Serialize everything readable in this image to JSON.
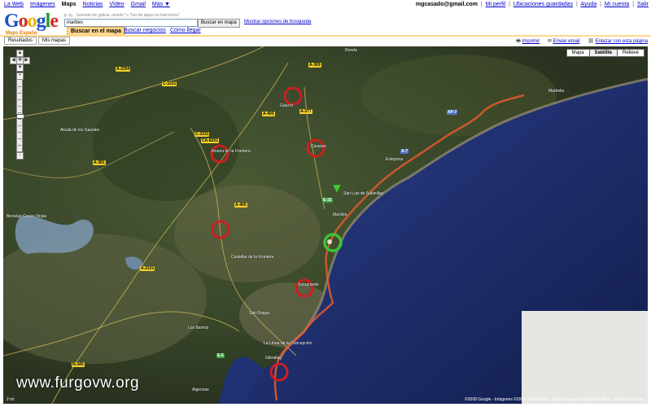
{
  "topnav": {
    "links": [
      "La Web",
      "Imágenes",
      "Maps",
      "Noticias",
      "Vídeo",
      "Gmail",
      "Más ▼"
    ],
    "active": "Maps",
    "user_email": "mgcasado@gmail.com",
    "user_links": [
      "Mi perfil",
      "Ubicaciones guardadas",
      "Ayuda",
      "Mi cuenta",
      "Salir"
    ]
  },
  "logo": {
    "word": "Google",
    "sub": "Maps España"
  },
  "search": {
    "hint": "p. ej., \"avenida de galicia, oviedo\" o \"bar de tapas en barcelona\"",
    "value": "marbes",
    "button": "Buscar en mapa",
    "options_link": "Mostrar opciones de búsqueda"
  },
  "tabs": [
    "Buscar en el mapa",
    "Buscar negocios",
    "Cómo llegar"
  ],
  "subtabs": [
    "Resultados",
    "Mis mapas"
  ],
  "maplinks": {
    "print": "Imprimir",
    "email": "Enviar email",
    "link": "Enlazar con esta página"
  },
  "maptypes": [
    "Mapa",
    "Satélite",
    "Relieve"
  ],
  "maptype_active": "Satélite",
  "watermark": "www.furgovw.org",
  "copyright": "©2008 Google - Imágenes ©2008 TerraMetrics, Datos de mapa ©2008 Tele Atlas - Términos de uso",
  "scale": "2 mi",
  "labels": [
    {
      "text": "Estepona",
      "id": "estepona"
    },
    {
      "text": "Marbella",
      "id": "marbella"
    },
    {
      "text": "Algeciras",
      "id": "algeciras"
    },
    {
      "text": "San Roque",
      "id": "sanroque"
    },
    {
      "text": "Gibraltar",
      "id": "gibraltar"
    },
    {
      "text": "La Línea de la Concepción",
      "id": "lalinea"
    },
    {
      "text": "Los Barrios",
      "id": "losbarrios"
    },
    {
      "text": "Castellar de la Frontera",
      "id": "castellar"
    },
    {
      "text": "Jimena de la Frontera",
      "id": "jimena"
    },
    {
      "text": "Benalup-Casas Viejas",
      "id": "benalup"
    },
    {
      "text": "Alcalá de los Gazules",
      "id": "alcala"
    },
    {
      "text": "Sotogrande",
      "id": "sotogrande"
    },
    {
      "text": "San Luis de Sabinillas",
      "id": "sabinillas"
    },
    {
      "text": "Manilva",
      "id": "manilva"
    },
    {
      "text": "Casares",
      "id": "casares"
    },
    {
      "text": "Gaucín",
      "id": "gaucin"
    },
    {
      "text": "Ronda",
      "id": "ronda"
    }
  ],
  "roads": [
    "A-2304",
    "C-3331",
    "A-369",
    "A-377",
    "A-405",
    "A-381",
    "A-7",
    "AP-7",
    "E-15",
    "A-405",
    "C-3331",
    "CA-8201",
    "A-2101",
    "N-340",
    "E-5"
  ],
  "colors": {
    "pin_red": "#cc1f1f",
    "pin_green": "#39c43a",
    "sea": "#1c2a6b",
    "land": "#3a4a2c"
  }
}
